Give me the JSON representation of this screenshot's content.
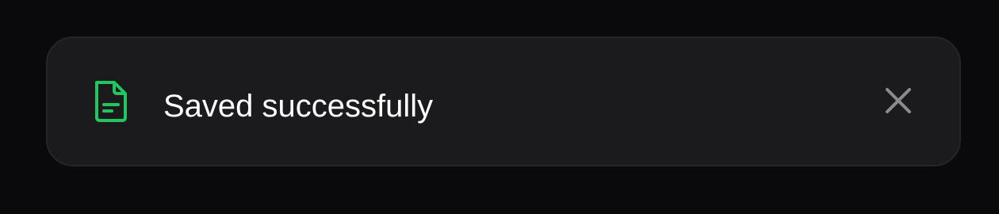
{
  "toast": {
    "message": "Saved successfully",
    "icon": "document-icon",
    "close_icon": "close-icon"
  },
  "colors": {
    "background": "#0a0a0d",
    "toast_background": "#1b1b1e",
    "toast_border": "#26262a",
    "success_accent": "#22c55e",
    "text": "#ffffff",
    "close_icon": "#8a8a90"
  }
}
